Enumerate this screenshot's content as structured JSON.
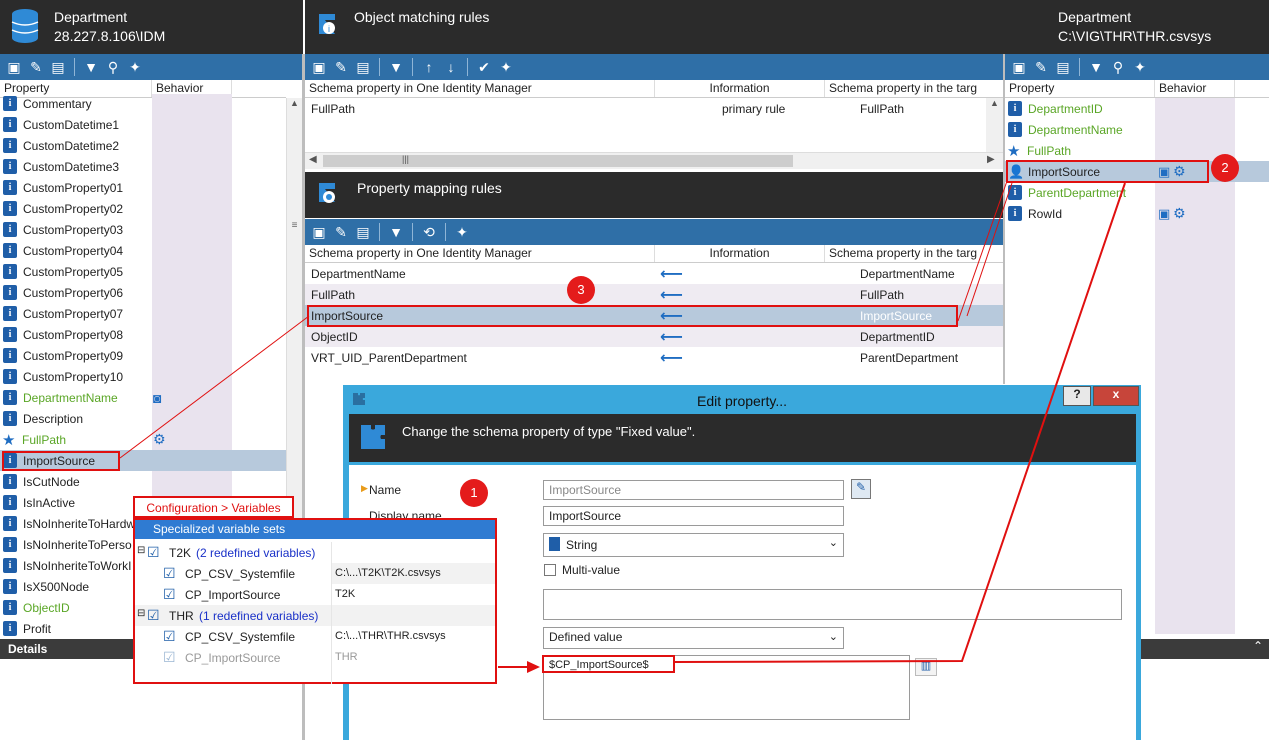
{
  "left": {
    "title": "Department",
    "subtitle": "28.227.8.106\\IDM",
    "col_property": "Property",
    "col_behavior": "Behavior",
    "items": [
      "Commentary",
      "CustomDatetime1",
      "CustomDatetime2",
      "CustomDatetime3",
      "CustomProperty01",
      "CustomProperty02",
      "CustomProperty03",
      "CustomProperty04",
      "CustomProperty05",
      "CustomProperty06",
      "CustomProperty07",
      "CustomProperty08",
      "CustomProperty09",
      "CustomProperty10",
      "DepartmentName",
      "Description",
      "FullPath",
      "ImportSource",
      "IsCutNode",
      "IsInActive",
      "IsNoInheriteToHardw",
      "IsNoInheriteToPerso",
      "IsNoInheriteToWorkI",
      "IsX500Node",
      "ObjectID",
      "Profit"
    ],
    "details": "Details"
  },
  "matching": {
    "title": "Object matching rules",
    "col1": "Schema property in One Identity Manager",
    "col2": "Information",
    "col3": "Schema property in the targ",
    "row": {
      "left": "FullPath",
      "info": "primary rule",
      "right": "FullPath"
    }
  },
  "mapping": {
    "title": "Property mapping rules",
    "col1": "Schema property in One Identity Manager",
    "col2": "Information",
    "col3": "Schema property in the targ",
    "rows": [
      {
        "left": "DepartmentName",
        "right": "DepartmentName"
      },
      {
        "left": "FullPath",
        "right": "FullPath"
      },
      {
        "left": "ImportSource",
        "right": "ImportSource"
      },
      {
        "left": "ObjectID",
        "right": "DepartmentID"
      },
      {
        "left": "VRT_UID_ParentDepartment",
        "right": "ParentDepartment"
      }
    ]
  },
  "right": {
    "title": "Department",
    "subtitle": "C:\\VIG\\THR\\THR.csvsys",
    "col_property": "Property",
    "col_behavior": "Behavior",
    "items": [
      "DepartmentID",
      "DepartmentName",
      "FullPath",
      "ImportSource",
      "ParentDepartment",
      "RowId"
    ]
  },
  "dialog": {
    "title": "Edit property...",
    "help": "?",
    "close": "x",
    "banner": "Change the schema property of type \"Fixed value\".",
    "name_label": "Name",
    "display_label": "Display name",
    "name_value": "ImportSource",
    "display_value": "ImportSource",
    "type_value": "String",
    "multivalue_label": "Multi-value",
    "value_mode": "Defined value",
    "value_text": "$CP_ImportSource$"
  },
  "variables": {
    "caption": "Configuration > Variables",
    "header": "Specialized variable sets",
    "t2k": "T2K",
    "t2k_note": "(2 redefined variables)",
    "t2k_sys": "CP_CSV_Systemfile",
    "t2k_sys_val": "C:\\...\\T2K\\T2K.csvsys",
    "t2k_imp": "CP_ImportSource",
    "t2k_imp_val": "T2K",
    "thr": "THR",
    "thr_note": "(1 redefined variables)",
    "thr_sys": "CP_CSV_Systemfile",
    "thr_sys_val": "C:\\...\\THR\\THR.csvsys",
    "thr_imp": "CP_ImportSource",
    "thr_imp_val": "THR"
  },
  "badges": [
    "1",
    "2",
    "3"
  ],
  "colors": {
    "toolbar": "#2f6fa7",
    "header": "#2b2b2b",
    "highlight": "#e01010",
    "dialog": "#3aa8dc",
    "green": "#5aa626"
  }
}
